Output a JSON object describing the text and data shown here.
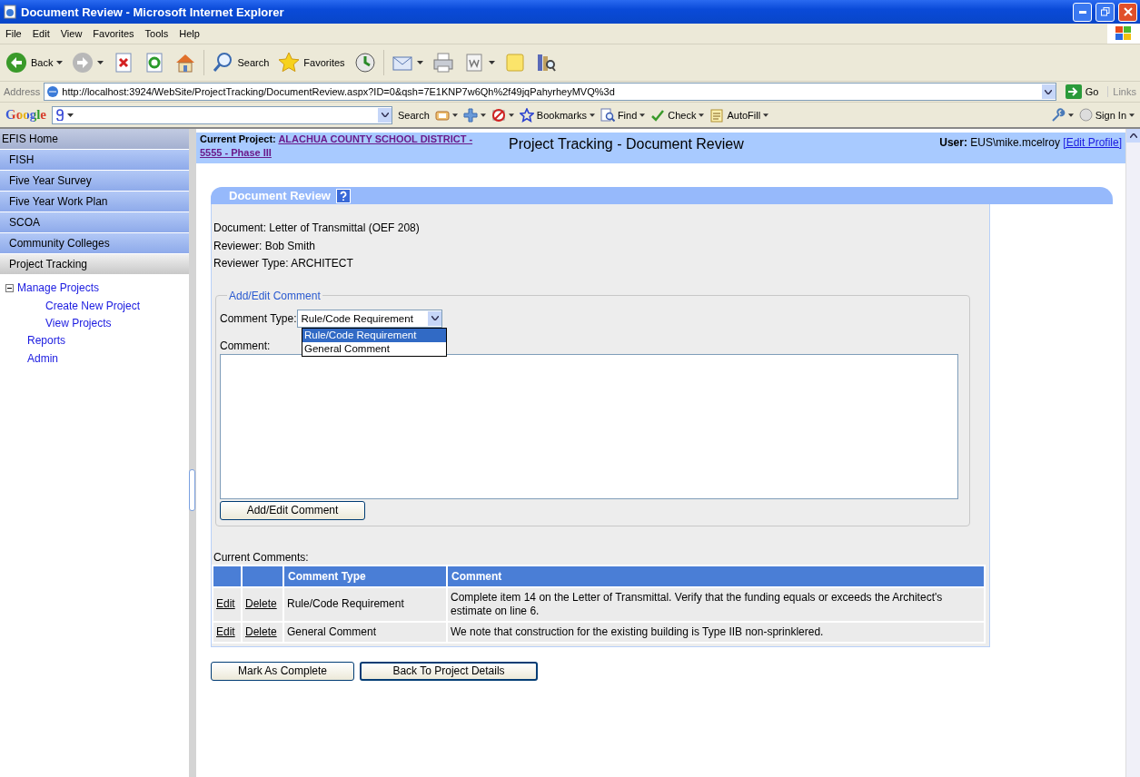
{
  "window": {
    "title": "Document Review - Microsoft Internet Explorer"
  },
  "menu": [
    "File",
    "Edit",
    "View",
    "Favorites",
    "Tools",
    "Help"
  ],
  "toolbar": [
    {
      "kind": "back",
      "label": "Back",
      "caret": true
    },
    {
      "kind": "forward",
      "caret": true
    },
    {
      "kind": "stop"
    },
    {
      "kind": "refresh"
    },
    {
      "kind": "home"
    },
    {
      "kind": "search",
      "label": "Search"
    },
    {
      "kind": "favorites",
      "label": "Favorites"
    },
    {
      "kind": "history"
    },
    {
      "kind": "mail",
      "caret": true
    },
    {
      "kind": "print"
    },
    {
      "kind": "word",
      "caret": true
    },
    {
      "kind": "note"
    },
    {
      "kind": "research"
    }
  ],
  "address": {
    "label": "Address",
    "url": "http://localhost:3924/WebSite/ProjectTracking/DocumentReview.aspx?ID=0&qsh=7E1KNP7w6Qh%2f49jqPahyrheyMVQ%3d",
    "go": "Go",
    "links": "Links"
  },
  "google_bar": {
    "logo": "Google",
    "items": [
      {
        "kind": "search",
        "label": "Search"
      },
      {
        "kind": "popup",
        "caret": true
      },
      {
        "kind": "plus",
        "caret": true
      },
      {
        "kind": "blocker",
        "caret": true
      },
      {
        "kind": "bookmarks",
        "label": "Bookmarks",
        "caret": true
      },
      {
        "kind": "find",
        "label": "Find",
        "caret": true
      },
      {
        "kind": "check",
        "label": "Check",
        "caret": true
      },
      {
        "kind": "autofill",
        "label": "AutoFill",
        "caret": true
      }
    ],
    "sign_in": "Sign In"
  },
  "sidebar": {
    "items": [
      {
        "label": "EFIS Home",
        "kind": "home",
        "selected": false
      },
      {
        "label": "FISH",
        "kind": "section",
        "selected": false
      },
      {
        "label": "Five Year Survey",
        "kind": "section",
        "selected": false
      },
      {
        "label": "Five Year Work Plan",
        "kind": "section",
        "selected": false
      },
      {
        "label": "SCOA",
        "kind": "section",
        "selected": false
      },
      {
        "label": "Community Colleges",
        "kind": "section",
        "selected": false
      },
      {
        "label": "Project Tracking",
        "kind": "section",
        "selected": true
      }
    ],
    "tree": [
      {
        "label": "Manage Projects",
        "expanded": true,
        "children": [
          {
            "label": "Create New Project"
          },
          {
            "label": "View Projects"
          }
        ]
      },
      {
        "label": "Reports"
      },
      {
        "label": "Admin"
      }
    ]
  },
  "header": {
    "project_label": "Current Project:",
    "project_lines": [
      "ALACHUA COUNTY SCHOOL DISTRICT -",
      "5555 - Phase III"
    ],
    "title": "Project Tracking - Document Review",
    "user_label": "User:",
    "user": "EUS\\mike.mcelroy",
    "edit_profile": "[Edit Profile]"
  },
  "panel": {
    "title": "Document Review",
    "info": [
      "Document: Letter of Transmittal (OEF 208)",
      "Reviewer: Bob Smith",
      "Reviewer Type: ARCHITECT"
    ],
    "form": {
      "legend": "Add/Edit Comment",
      "type_label": "Comment Type:",
      "type_value": "Rule/Code Requirement",
      "options": [
        {
          "label": "Rule/Code Requirement",
          "selected": true
        },
        {
          "label": "General Comment",
          "selected": false
        }
      ],
      "comment_label": "Comment:",
      "button": "Add/Edit Comment"
    },
    "comments_label": "Current Comments:",
    "table": {
      "columns": [
        "Comment Type",
        "Comment"
      ],
      "rows": [
        {
          "edit": "Edit",
          "delete": "Delete",
          "type": "Rule/Code Requirement",
          "comment": "Complete item 14 on the Letter of Transmittal. Verify that the funding equals or exceeds the Architect's estimate on line 6."
        },
        {
          "edit": "Edit",
          "delete": "Delete",
          "type": "General Comment",
          "comment": "We note that construction for the existing building is Type IIB non-sprinklered."
        }
      ]
    }
  },
  "actions": [
    {
      "label": "Mark As Complete",
      "focused": false
    },
    {
      "label": "Back To Project Details",
      "focused": true
    }
  ]
}
